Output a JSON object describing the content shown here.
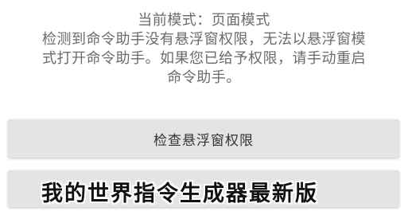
{
  "dialog": {
    "message_lines": [
      "当前模式：页面模式",
      "检测到命令助手没有悬浮窗权限，无法以悬浮窗模",
      "式打开命令助手。如果您已给予权限，请手动重启",
      "命令助手。"
    ],
    "check_button_label": "检查悬浮窗权限",
    "second_button_label": ""
  },
  "watermark": {
    "text": "我的世界指令生成器最新版"
  }
}
